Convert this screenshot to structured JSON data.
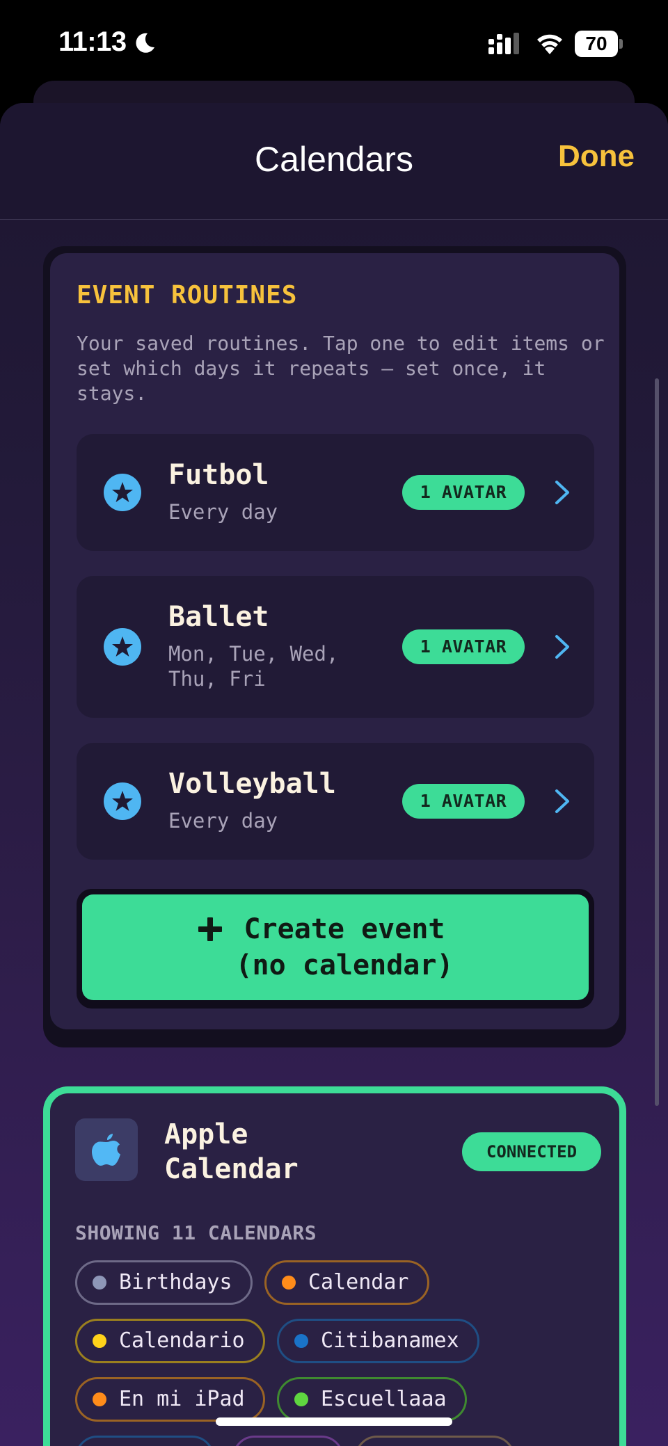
{
  "status_bar": {
    "time": "11:13",
    "battery": "70",
    "icons": [
      "moon-icon",
      "signal-icon",
      "wifi-icon",
      "battery-icon"
    ]
  },
  "nav": {
    "title": "Calendars",
    "done_label": "Done"
  },
  "routines": {
    "heading": "EVENT ROUTINES",
    "description": "Your saved routines. Tap one to edit items or set which days it repeats — set once, it stays.",
    "items": [
      {
        "name": "Futbol",
        "days": "Every day",
        "badge": "1 AVATAR"
      },
      {
        "name": "Ballet",
        "days": "Mon, Tue, Wed, Thu, Fri",
        "badge": "1 AVATAR"
      },
      {
        "name": "Volleyball",
        "days": "Every day",
        "badge": "1 AVATAR"
      }
    ],
    "create_label": "Create event\n(no calendar)"
  },
  "apple_calendar": {
    "title": "Apple Calendar",
    "status": "CONNECTED",
    "showing": "SHOWING 11 CALENDARS",
    "calendars": [
      {
        "name": "Birthdays",
        "color": "#8e97b8"
      },
      {
        "name": "Calendar",
        "color": "#ff8c1a"
      },
      {
        "name": "Calendario",
        "color": "#ffd21a"
      },
      {
        "name": "Citibanamex",
        "color": "#1a73c8"
      },
      {
        "name": "En mi iPad",
        "color": "#ff8c1a"
      },
      {
        "name": "Escuellaaa",
        "color": "#5fd640"
      }
    ]
  },
  "colors": {
    "accent_green": "#3ddc97",
    "accent_yellow": "#f7c23c",
    "star_blue": "#4fb6f2"
  }
}
